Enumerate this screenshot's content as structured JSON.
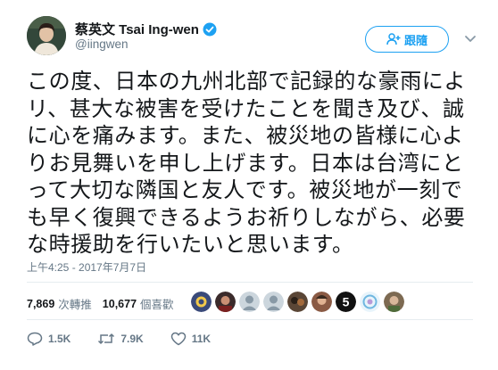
{
  "author": {
    "display_name": "蔡英文 Tsai Ing-wen",
    "handle": "@iingwen",
    "verified": true
  },
  "follow_button": {
    "label": "跟隨",
    "icon": "person-plus-icon"
  },
  "menu_icon": "chevron-down-icon",
  "tweet": {
    "text": "この度、日本の九州北部で記録的な豪雨によ\nリ、甚大な被害を受けたことを聞き及び、誠\nに心を痛みます。また、被災地の皆様に心よ\nりお見舞いを申し上げます。日本は台湾にと\nって大切な隣国と友人です。被災地が一刻で\nも早く復興できるようお祈りしながら、必要\nな時援助を行いたいと思います。",
    "timestamp": "上午4:25 - 2017年7月7日"
  },
  "stats": {
    "retweets_count": "7,869",
    "retweets_label": "次轉推",
    "likes_count": "10,677",
    "likes_label": "個喜歡"
  },
  "liker_avatars": [
    {
      "name": "liker-avatar-1",
      "color": "#3a4a7a"
    },
    {
      "name": "liker-avatar-2",
      "color": "#3b2b2b"
    },
    {
      "name": "liker-avatar-3",
      "color": "#a7b6c2"
    },
    {
      "name": "liker-avatar-4",
      "color": "#9aa8b4"
    },
    {
      "name": "liker-avatar-5",
      "color": "#5a4636"
    },
    {
      "name": "liker-avatar-6",
      "color": "#8a5a44"
    },
    {
      "name": "liker-avatar-7",
      "color": "#111111"
    },
    {
      "name": "liker-avatar-8",
      "color": "#6fb7e0"
    },
    {
      "name": "liker-avatar-9",
      "color": "#7d6a52"
    }
  ],
  "liker_avatar_7_text": "5",
  "actions": {
    "reply_count": "1.5K",
    "retweet_count": "7.9K",
    "like_count": "11K"
  },
  "colors": {
    "accent": "#1da1f2",
    "secondary_text": "#657786",
    "divider": "#e6ecf0"
  }
}
